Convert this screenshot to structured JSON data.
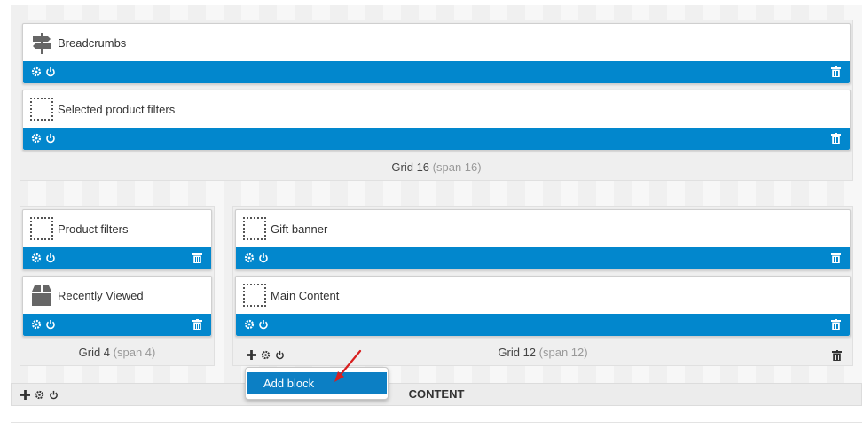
{
  "rows": {
    "top": {
      "grid_name": "Grid 16",
      "grid_span": "(span 16)",
      "blocks": [
        {
          "title": "Breadcrumbs",
          "icon": "signpost-icon"
        },
        {
          "title": "Selected product filters",
          "icon": "placeholder-icon"
        }
      ]
    },
    "left": {
      "grid_name": "Grid 4",
      "grid_span": "(span 4)",
      "blocks": [
        {
          "title": "Product filters",
          "icon": "placeholder-icon"
        },
        {
          "title": "Recently Viewed",
          "icon": "box-icon"
        }
      ]
    },
    "right": {
      "grid_name": "Grid 12",
      "grid_span": "(span 12)",
      "blocks": [
        {
          "title": "Gift banner",
          "icon": "placeholder-icon"
        },
        {
          "title": "Main Content",
          "icon": "placeholder-icon"
        }
      ]
    }
  },
  "content_bar": {
    "label": "CONTENT"
  },
  "dropdown": {
    "items": [
      "Add block"
    ]
  },
  "colors": {
    "accent": "#0287cd",
    "background": "#efefef"
  }
}
